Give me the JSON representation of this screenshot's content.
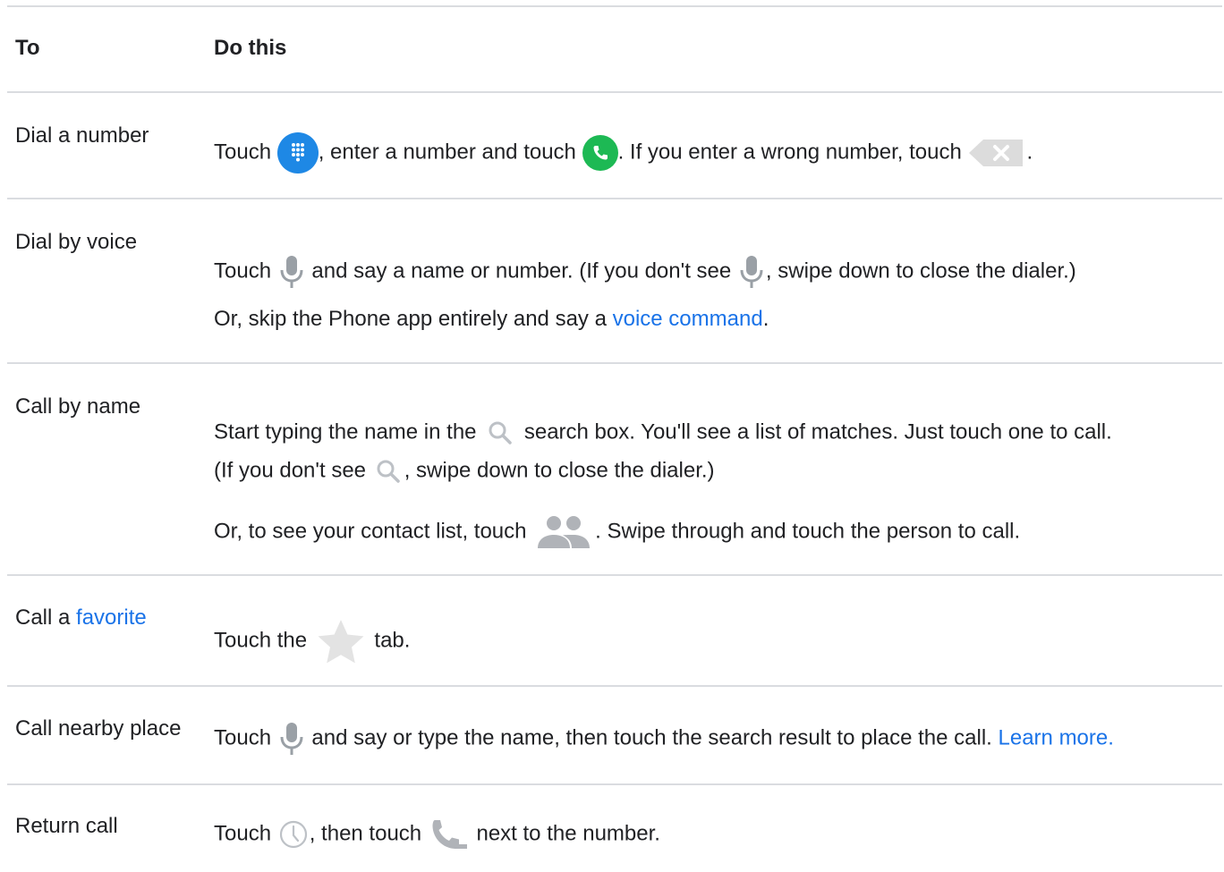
{
  "header": {
    "col_to": "To",
    "col_do": "Do this"
  },
  "rows": [
    {
      "to": "Dial a number",
      "do": {
        "t1": "Touch ",
        "t2": ", enter a number and touch ",
        "t3": ". If you enter a wrong number, touch ",
        "t4": "."
      },
      "icons": [
        "dialpad-icon",
        "call-icon",
        "backspace-icon"
      ]
    },
    {
      "to": "Dial by voice",
      "do": {
        "t1": "Touch ",
        "t2": " and say a name or number. (If you don't see ",
        "t3": ", swipe down to close the dialer.)",
        "p2_t1": "Or, skip the Phone app entirely and say a ",
        "p2_link": "voice command",
        "p2_t2": "."
      },
      "icons": [
        "microphone-icon"
      ]
    },
    {
      "to": "Call by name",
      "do": {
        "t1": "Start typing the name in the ",
        "t2": " search box. You'll see a list of matches. Just touch one to call.",
        "t3": "(If you don't see ",
        "t4": ", swipe down to close the dialer.)",
        "p2_t1": "Or, to see your contact list, touch ",
        "p2_t2": ". Swipe through and touch the person to call."
      },
      "icons": [
        "search-icon",
        "contacts-icon"
      ]
    },
    {
      "to_prefix": "Call a ",
      "to_link": "favorite",
      "do": {
        "t1": "Touch the ",
        "t2": " tab."
      },
      "icons": [
        "star-icon"
      ]
    },
    {
      "to": "Call nearby place",
      "do": {
        "t1": "Touch ",
        "t2": " and say or type the name, then touch the search result to place the call. ",
        "link": "Learn more."
      },
      "icons": [
        "microphone-icon"
      ]
    },
    {
      "to": "Return call",
      "do": {
        "t1": "Touch ",
        "t2": ", then touch ",
        "t3": " next to the number."
      },
      "icons": [
        "clock-icon",
        "phone-handset-icon"
      ]
    }
  ],
  "colors": {
    "text": "#202124",
    "link": "#1a73e8",
    "divider": "#dadce0",
    "dialpad_blue": "#1e88e5",
    "call_green": "#1db954",
    "icon_gray": "#9aa0a6"
  }
}
